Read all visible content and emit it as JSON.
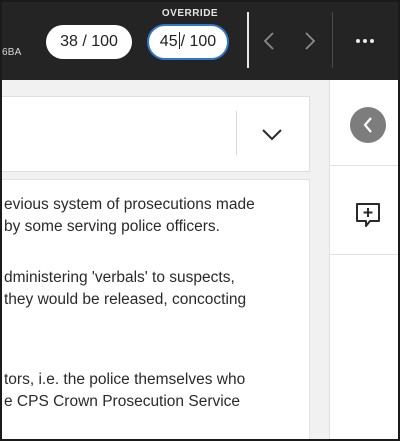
{
  "header": {
    "id_fragment": "6BA",
    "score": "38 / 100",
    "override": {
      "label": "OVERRIDE",
      "value": "45",
      "suffix": "/ 100"
    }
  },
  "icons": {
    "prev": "chevron-left-icon",
    "next": "chevron-right-icon",
    "more": "more-horizontal-icon",
    "dropdown": "chevron-down-icon",
    "collapse": "chevron-left-circle-icon",
    "comment": "add-comment-icon"
  },
  "colors": {
    "topbar": "#242424",
    "override_border": "#2f77c9",
    "collapse_bg": "#7d7d7d"
  },
  "content": {
    "paragraphs": [
      [
        "evious system of prosecutions made",
        "by some serving police officers."
      ],
      [
        "dministering 'verbals' to suspects,",
        "they would be released, concocting"
      ],
      [
        "tors, i.e. the police themselves who",
        "e CPS Crown Prosecution Service"
      ]
    ]
  }
}
